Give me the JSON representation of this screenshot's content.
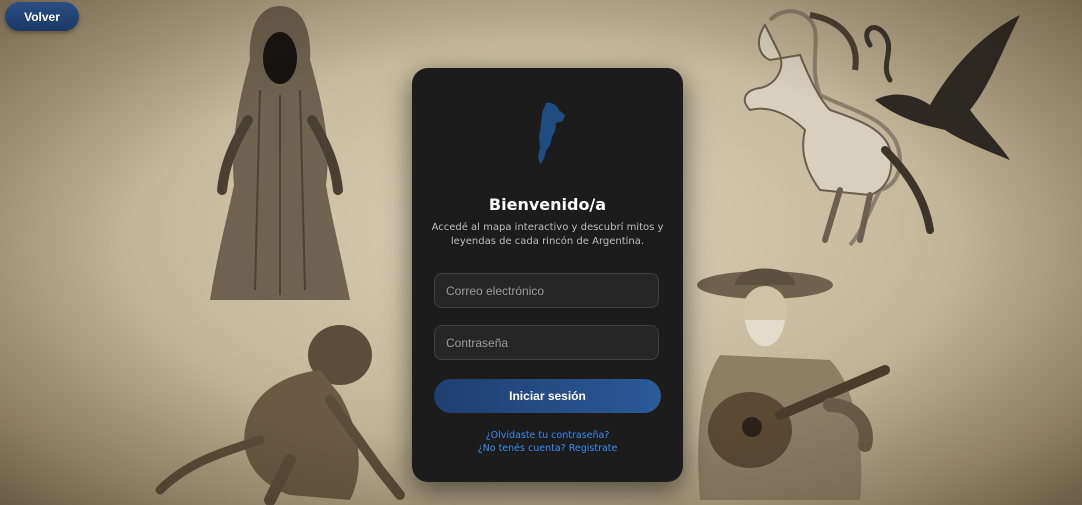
{
  "header": {
    "back_label": "Volver"
  },
  "login": {
    "logo_icon": "argentina-map-icon",
    "title": "Bienvenido/a",
    "subtitle": "Accedé al mapa interactivo y descubrí mitos y leyendas de cada rincón de Argentina.",
    "email_placeholder": "Correo electrónico",
    "email_value": "",
    "password_placeholder": "Contraseña",
    "password_value": "",
    "submit_label": "Iniciar sesión",
    "forgot_link": "¿Olvidaste tu contraseña?",
    "register_link": "¿No tenés cuenta? Registrate"
  },
  "colors": {
    "card_bg": "#1c1c1c",
    "accent_blue": "#2b5a97",
    "link_blue": "#3a8df0",
    "background_parchment": "#d9cfb6"
  }
}
